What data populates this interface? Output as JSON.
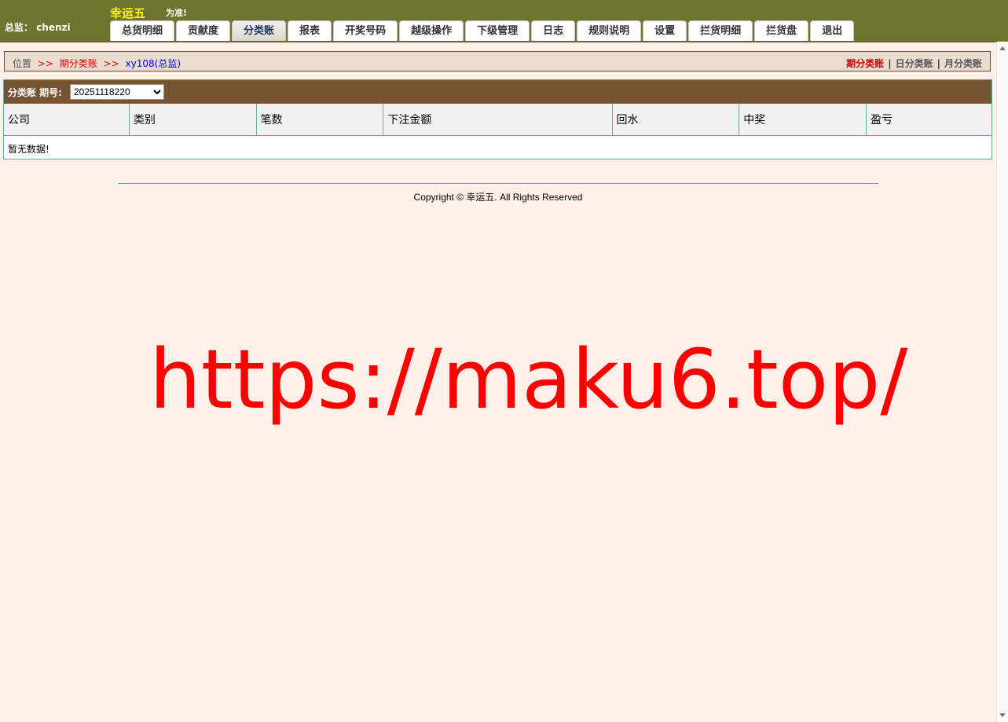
{
  "header": {
    "user_info": "总监： chenzi",
    "brand": "幸运五",
    "brand_note": "为准!",
    "tabs": [
      {
        "label": "总货明细"
      },
      {
        "label": "贡献度"
      },
      {
        "label": "分类账",
        "active": true
      },
      {
        "label": "报表"
      },
      {
        "label": "开奖号码"
      },
      {
        "label": "越级操作"
      },
      {
        "label": "下级管理"
      },
      {
        "label": "日志"
      },
      {
        "label": "规则说明"
      },
      {
        "label": "设置"
      },
      {
        "label": "拦货明细"
      },
      {
        "label": "拦货盘"
      },
      {
        "label": "退出"
      }
    ]
  },
  "breadcrumb": {
    "position": "位置",
    "sep": ">>",
    "current": "期分类账",
    "user": "xy108(总监)",
    "links": [
      "期分类账",
      "日分类账",
      "月分类账"
    ]
  },
  "panel": {
    "label": "分类账 期号:",
    "period_value": "20251118220",
    "columns": [
      "公司",
      "类别",
      "笔数",
      "下注金额",
      "回水",
      "中奖",
      "盈亏"
    ],
    "empty_text": "暂无数据!"
  },
  "footer": {
    "copyright": "Copyright © 幸运五. All Rights Reserved"
  },
  "watermark": "https://maku6.top/",
  "colors": {
    "topbar": "#6e742f",
    "brand": "#ffff00",
    "panel_header": "#765331",
    "breadcrumb_bg": "#eadccf",
    "background": "#fff1e9",
    "watermark": "#ff0000"
  }
}
